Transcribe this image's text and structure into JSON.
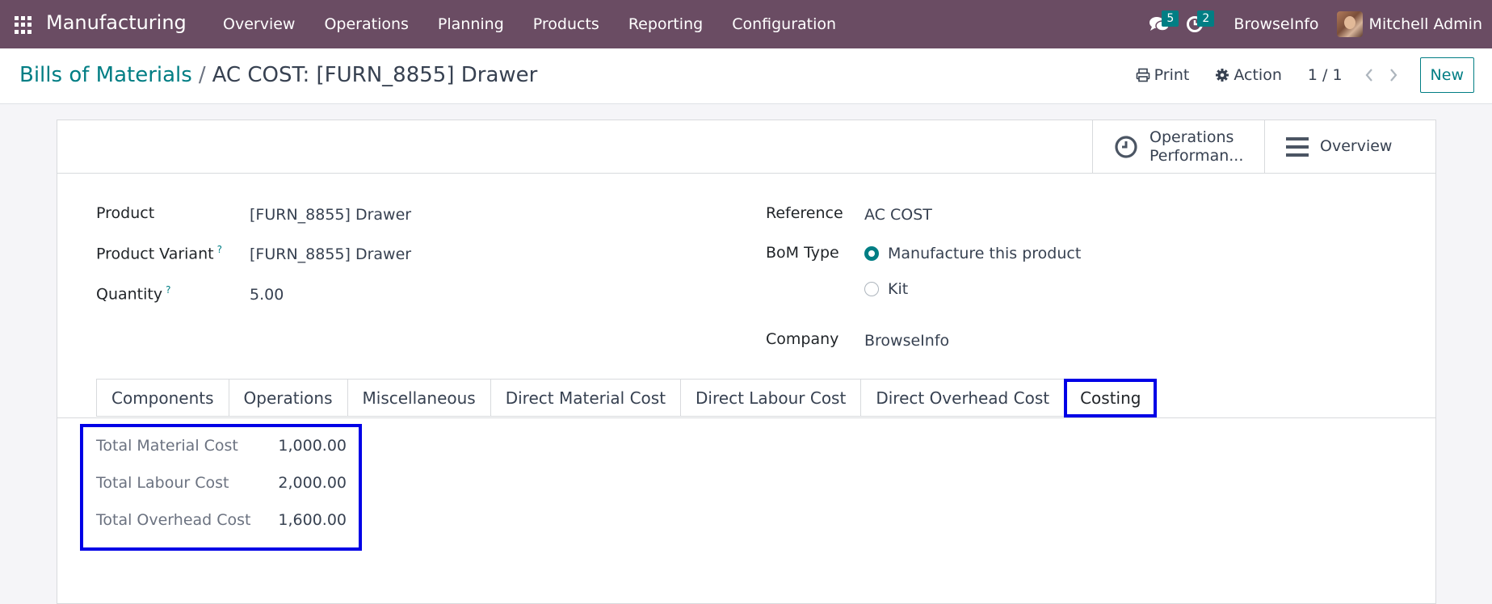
{
  "navbar": {
    "app_title": "Manufacturing",
    "menu": [
      "Overview",
      "Operations",
      "Planning",
      "Products",
      "Reporting",
      "Configuration"
    ],
    "messages_count": "5",
    "activities_count": "2",
    "company": "BrowseInfo",
    "user": "Mitchell Admin",
    "color": "#6a4c63"
  },
  "control_panel": {
    "breadcrumb_parent": "Bills of Materials",
    "breadcrumb_separator": "/",
    "breadcrumb_current": "AC COST: [FURN_8855] Drawer",
    "print_label": "Print",
    "action_label": "Action",
    "pager": "1 / 1",
    "new_label": "New"
  },
  "button_box": {
    "operations_performance": [
      "Operations",
      "Performan..."
    ],
    "overview": "Overview"
  },
  "form": {
    "product_label": "Product",
    "product_value": "[FURN_8855] Drawer",
    "variant_label": "Product Variant",
    "variant_value": "[FURN_8855] Drawer",
    "quantity_label": "Quantity",
    "quantity_value": "5.00",
    "help_mark": "?",
    "reference_label": "Reference",
    "reference_value": "AC COST",
    "bom_type_label": "BoM Type",
    "bom_type_options": [
      "Manufacture this product",
      "Kit"
    ],
    "company_label": "Company",
    "company_value": "BrowseInfo"
  },
  "tabs": [
    "Components",
    "Operations",
    "Miscellaneous",
    "Direct Material Cost",
    "Direct Labour Cost",
    "Direct Overhead Cost",
    "Costing"
  ],
  "active_tab": "Costing",
  "costing": {
    "rows": [
      {
        "label": "Total Material Cost",
        "value": "1,000.00"
      },
      {
        "label": "Total Labour Cost",
        "value": "2,000.00"
      },
      {
        "label": "Total Overhead Cost",
        "value": "1,600.00"
      }
    ]
  },
  "colors": {
    "accent": "#017e84",
    "highlight": "#0000e6"
  }
}
